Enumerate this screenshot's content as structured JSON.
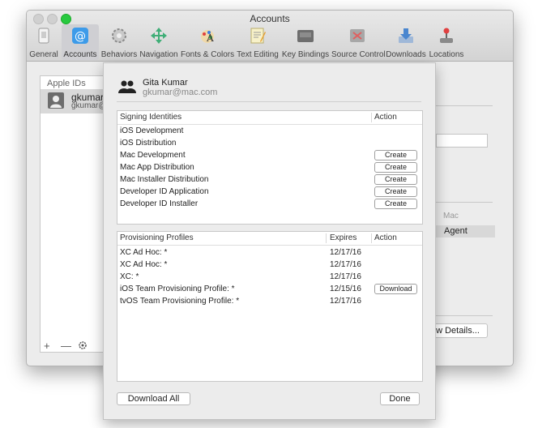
{
  "window": {
    "title": "Accounts",
    "toolbar": [
      {
        "label": "General",
        "icon": "general-icon"
      },
      {
        "label": "Accounts",
        "icon": "at-icon"
      },
      {
        "label": "Behaviors",
        "icon": "gears-icon"
      },
      {
        "label": "Navigation",
        "icon": "navigation-arrows-icon"
      },
      {
        "label": "Fonts & Colors",
        "icon": "font-palette-icon"
      },
      {
        "label": "Text Editing",
        "icon": "text-editing-icon"
      },
      {
        "label": "Key Bindings",
        "icon": "keyboard-icon"
      },
      {
        "label": "Source Control",
        "icon": "source-control-icon"
      },
      {
        "label": "Downloads",
        "icon": "downloads-icon"
      },
      {
        "label": "Locations",
        "icon": "joystick-icon"
      }
    ],
    "active_tab": "Accounts"
  },
  "ids_panel": {
    "header": "Apple IDs",
    "account_name": "gkumar@",
    "account_email": "gkumar@",
    "add_label": "+",
    "remove_label": "—",
    "settings_icon": "gear-icon"
  },
  "right_panel": {
    "col_mac": "Mac",
    "role": "Agent",
    "details_button": "w Details..."
  },
  "sheet": {
    "user_name": "Gita Kumar",
    "user_email": "gkumar@mac.com",
    "signing": {
      "col_identity": "Signing Identities",
      "col_action": "Action",
      "rows": [
        {
          "name": "iOS Development",
          "action": ""
        },
        {
          "name": "iOS Distribution",
          "action": ""
        },
        {
          "name": "Mac Development",
          "action": "Create"
        },
        {
          "name": "Mac App Distribution",
          "action": "Create"
        },
        {
          "name": "Mac Installer Distribution",
          "action": "Create"
        },
        {
          "name": "Developer ID Application",
          "action": "Create"
        },
        {
          "name": "Developer ID Installer",
          "action": "Create"
        }
      ]
    },
    "profiles": {
      "col_profile": "Provisioning Profiles",
      "col_expires": "Expires",
      "col_action": "Action",
      "rows": [
        {
          "name": "XC Ad Hoc: *",
          "expires": "12/17/16",
          "action": ""
        },
        {
          "name": "XC Ad Hoc: *",
          "expires": "12/17/16",
          "action": ""
        },
        {
          "name": "XC: *",
          "expires": "12/17/16",
          "action": ""
        },
        {
          "name": "iOS Team Provisioning Profile: *",
          "expires": "12/15/16",
          "action": "Download"
        },
        {
          "name": "tvOS Team Provisioning Profile: *",
          "expires": "12/17/16",
          "action": ""
        }
      ]
    },
    "download_all": "Download All",
    "done": "Done"
  }
}
